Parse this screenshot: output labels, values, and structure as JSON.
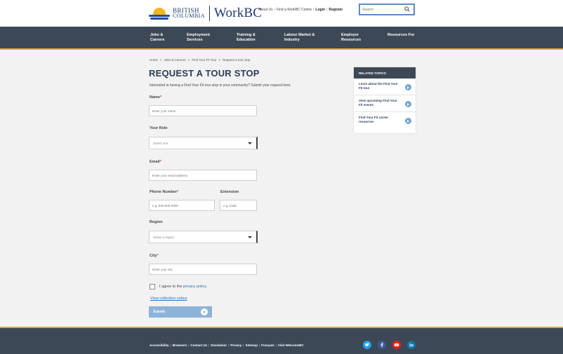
{
  "header": {
    "logo_line1": "BRITISH",
    "logo_line2": "COLUMBIA",
    "brand": "WorkBC",
    "util_links": [
      "About Us",
      "Find a WorkBC Centre"
    ],
    "login": "Login",
    "register": "Register",
    "search_placeholder": "Search"
  },
  "nav": {
    "items": [
      {
        "line1": "Jobs &",
        "line2": "Careers"
      },
      {
        "line1": "Employment",
        "line2": "Services"
      },
      {
        "line1": "Training &",
        "line2": "Education"
      },
      {
        "line1": "Labour Market &",
        "line2": "Industry"
      },
      {
        "line1": "Employer",
        "line2": "Resources"
      },
      {
        "line1": "Resources For",
        "line2": ""
      }
    ]
  },
  "breadcrumb": [
    "Home",
    "Jobs & Careers",
    "Find Your Fit Tour",
    "Request a tour stop"
  ],
  "page": {
    "title": "REQUEST A TOUR STOP",
    "intro": "Interested in having a Find Your Fit tour stop in your community? Submit your request here."
  },
  "form": {
    "name_label": "Name",
    "name_placeholder": "Enter your name",
    "role_label": "Your Role",
    "role_value": "Select one",
    "email_label": "Email",
    "email_placeholder": "Enter your email address",
    "phone_label": "Phone Number",
    "phone_placeholder": "e.g. 000-000-0000",
    "extension_label": "Extension",
    "extension_placeholder": "e.g. 2155",
    "region_label": "Region",
    "region_value": "Select a region",
    "city_label": "City",
    "city_placeholder": "Enter your city",
    "required_mark": "*",
    "agree_prefix": "I agree to the",
    "privacy_link": "privacy policy",
    "agree_suffix": ".",
    "collection_notice": "View collection notice",
    "submit_label": "Submit"
  },
  "related": {
    "heading": "RELATED TOPICS",
    "items": [
      "Learn about the Find Your Fit tour",
      "View upcoming Find Your Fit events",
      "Find Your Fit career resources"
    ]
  },
  "footer": {
    "links": [
      "Accessibility",
      "Browsers",
      "Contact Us",
      "Disclaimer",
      "Privacy",
      "Sitemap",
      "Français",
      "Visit WelcomeBC"
    ],
    "social": [
      {
        "name": "twitter-icon",
        "color": "#1da1f2"
      },
      {
        "name": "facebook-icon",
        "color": "#3b5998"
      },
      {
        "name": "youtube-icon",
        "color": "#e62117"
      },
      {
        "name": "linkedin-icon",
        "color": "#0e76a8"
      }
    ]
  },
  "colors": {
    "nav_bg": "#3d4856",
    "accent_gold": "#e3a82b",
    "link_blue": "#2f6fb8",
    "submit_bg": "#8db3d8",
    "title_navy": "#2c3d56"
  }
}
